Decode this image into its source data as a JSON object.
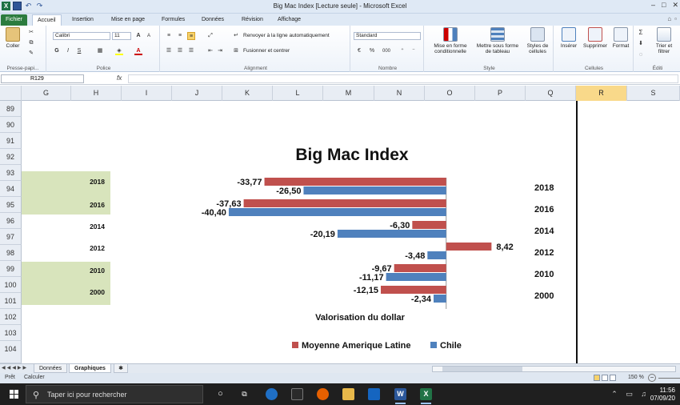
{
  "titlebar": {
    "title": "Big Mac Index  [Lecture seule]  -  Microsoft Excel",
    "logo": "X",
    "minimize": "–",
    "maximize": "□",
    "close": "✕"
  },
  "tabs": {
    "file": "Fichier",
    "items": [
      "Accueil",
      "Insertion",
      "Mise en page",
      "Formules",
      "Données",
      "Révision",
      "Affichage"
    ]
  },
  "ribbon": {
    "clipboard": {
      "paste": "Coller",
      "label": "Presse-papi..."
    },
    "font": {
      "name": "Calibri",
      "size": "11",
      "bold": "G",
      "italic": "I",
      "underline": "S",
      "label": "Police"
    },
    "alignment": {
      "wrap": "Renvoyer à la ligne automatiquement",
      "merge": "Fusionner et centrer",
      "label": "Alignment"
    },
    "number": {
      "format": "Standard",
      "percent": "%",
      "thousands": "000",
      "label": "Nombre"
    },
    "style": {
      "conditional": "Mise en forme conditionnelle",
      "table": "Mettre sous forme de tableau",
      "cellstyles": "Styles de cellules",
      "label": "Style"
    },
    "cells": {
      "insert": "Insérer",
      "delete": "Supprimer",
      "format": "Format",
      "label": "Cellules"
    },
    "editing": {
      "sort": "Trier et filtrer",
      "label": "Éditi"
    }
  },
  "formula": {
    "namebox": "R129",
    "fx": "fx"
  },
  "columns": [
    "G",
    "H",
    "I",
    "J",
    "K",
    "L",
    "M",
    "N",
    "O",
    "P",
    "Q",
    "R",
    "S"
  ],
  "selected_column": "R",
  "rows": [
    "89",
    "90",
    "91",
    "92",
    "93",
    "94",
    "95",
    "96",
    "97",
    "98",
    "99",
    "100",
    "101",
    "102",
    "103",
    "104"
  ],
  "cells": {
    "years": [
      {
        "row": "94",
        "value": "2018",
        "green": true
      },
      {
        "row": "95",
        "value": "2016",
        "green": true
      },
      {
        "row": "96",
        "value": "2014",
        "green": false
      },
      {
        "row": "97",
        "value": "2012",
        "green": false
      },
      {
        "row": "98",
        "value": "2010",
        "green": true
      },
      {
        "row": "99",
        "value": "2000",
        "green": true
      }
    ]
  },
  "chart_data": {
    "type": "bar",
    "orientation": "horizontal",
    "title": "Big Mac Index",
    "xlabel": "Valorisation du dollar",
    "ylabel": "",
    "categories": [
      "2018",
      "2016",
      "2014",
      "2012",
      "2010",
      "2000"
    ],
    "series": [
      {
        "name": "Moyenne Amerique Latine",
        "color": "#c0504d",
        "values": [
          -33.77,
          -37.63,
          -6.3,
          8.42,
          -9.67,
          -12.15
        ],
        "labels": [
          "-33,77",
          "-37,63",
          "-6,30",
          "8,42",
          "-9,67",
          "-12,15"
        ]
      },
      {
        "name": "Chile",
        "color": "#4f81bd",
        "values": [
          -26.5,
          -40.4,
          -20.19,
          -3.48,
          -11.17,
          -2.34
        ],
        "labels": [
          "-26,50",
          "-40,40",
          "-20,19",
          "-3,48",
          "-11,17",
          "-2,34"
        ]
      }
    ],
    "xlim": [
      -45,
      10
    ],
    "legend_position": "bottom",
    "grid": false
  },
  "sheets": {
    "tabs": [
      "Données",
      "Graphiques"
    ],
    "active": "Graphiques"
  },
  "status": {
    "ready": "Prêt",
    "calc": "Calculer",
    "zoom": "150 %"
  },
  "taskbar": {
    "search_placeholder": "Taper ici pour rechercher",
    "time": "11:56",
    "date": "07/09/20"
  }
}
